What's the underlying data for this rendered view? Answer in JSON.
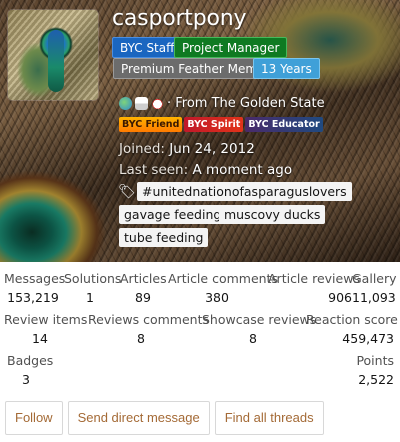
{
  "profile": {
    "username": "casportpony",
    "badges": {
      "staff": "BYC Staff",
      "project_manager": "Project Manager",
      "premium": "Premium Feather Member",
      "years": "13 Years"
    },
    "origin": "· From The Golden State",
    "trophies": [
      "BYC Friend",
      "BYC Spirit",
      "BYC Educator"
    ],
    "joined_label": "Joined:",
    "joined_value": "Jun 24, 2012",
    "last_seen_label": "Last seen:",
    "last_seen_value": "A moment ago",
    "tags": [
      "#unitednationofasparaguslovers",
      "gavage feeding",
      "muscovy ducks",
      "tube feeding"
    ],
    "icons": [
      "globe-icon",
      "flag-icon",
      "chicken-icon",
      "tag-icon"
    ]
  },
  "stats": {
    "messages": {
      "label": "Messages",
      "value": "153,219"
    },
    "solutions": {
      "label": "Solutions",
      "value": "1"
    },
    "articles": {
      "label": "Articles",
      "value": "89"
    },
    "article_comments": {
      "label": "Article comments",
      "value": "380"
    },
    "article_reviews": {
      "label": "Article reviews",
      "value": "906"
    },
    "gallery": {
      "label": "Gallery",
      "value": "11,093"
    },
    "review_items": {
      "label": "Review items",
      "value": "14"
    },
    "reviews_comments": {
      "label": "Reviews comments",
      "value": "8"
    },
    "showcase_reviews": {
      "label": "Showcase reviews",
      "value": "8"
    },
    "reaction_score": {
      "label": "Reaction score",
      "value": "459,473"
    },
    "badges": {
      "label": "Badges",
      "value": "3"
    },
    "points": {
      "label": "Points",
      "value": "2,522"
    }
  },
  "actions": {
    "follow": "Follow",
    "send_dm": "Send direct message",
    "find_threads": "Find all threads"
  },
  "colors": {
    "staff": "#1a66c0",
    "project_manager": "#0f7a22",
    "premium": "#6c6c6c",
    "years": "#3fa0d8",
    "link": "#a46a36"
  }
}
